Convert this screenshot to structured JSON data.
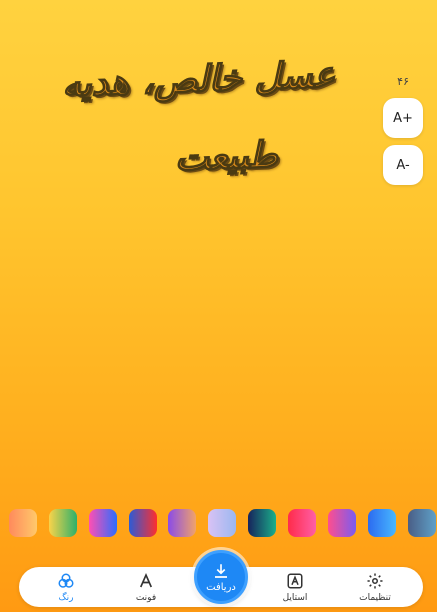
{
  "canvas": {
    "line1": "عسل خالص، هدیه",
    "line2": "طبیعت"
  },
  "size": {
    "value": "۴۶",
    "increase_label": "A+",
    "decrease_label": "A-"
  },
  "swatches": [
    {
      "name": "orange-light",
      "gradient": [
        "#FF8A5C",
        "#FFC96B"
      ]
    },
    {
      "name": "yellow-green",
      "gradient": [
        "#F9D34A",
        "#2DB06A"
      ]
    },
    {
      "name": "pink-blue",
      "gradient": [
        "#FF4FB3",
        "#2B6DFF"
      ]
    },
    {
      "name": "blue-red",
      "gradient": [
        "#2C5BD6",
        "#FF2E2E"
      ]
    },
    {
      "name": "purple-orange",
      "gradient": [
        "#8A4BE8",
        "#F0A36A"
      ]
    },
    {
      "name": "lavender-blue",
      "gradient": [
        "#D9C2F4",
        "#9BB8F0"
      ]
    },
    {
      "name": "navy-teal",
      "gradient": [
        "#17235C",
        "#1BB08A"
      ]
    },
    {
      "name": "red-pink",
      "gradient": [
        "#FF2B4A",
        "#FF5FA6"
      ]
    },
    {
      "name": "pink-purple",
      "gradient": [
        "#FF4E8E",
        "#7A5CF0"
      ]
    },
    {
      "name": "sky-blue",
      "gradient": [
        "#2C6BF0",
        "#48B8FF"
      ]
    },
    {
      "name": "slate",
      "gradient": [
        "#4A5E86",
        "#5FA1C8"
      ]
    }
  ],
  "nav": {
    "settings_label": "تنظیمات",
    "style_label": "استایل",
    "download_label": "دریافت",
    "font_label": "فونت",
    "color_label": "رنگ"
  },
  "colors": {
    "accent": "#1E88F5",
    "background_top": "#FFD23F",
    "background_bottom": "#FF9A12"
  }
}
